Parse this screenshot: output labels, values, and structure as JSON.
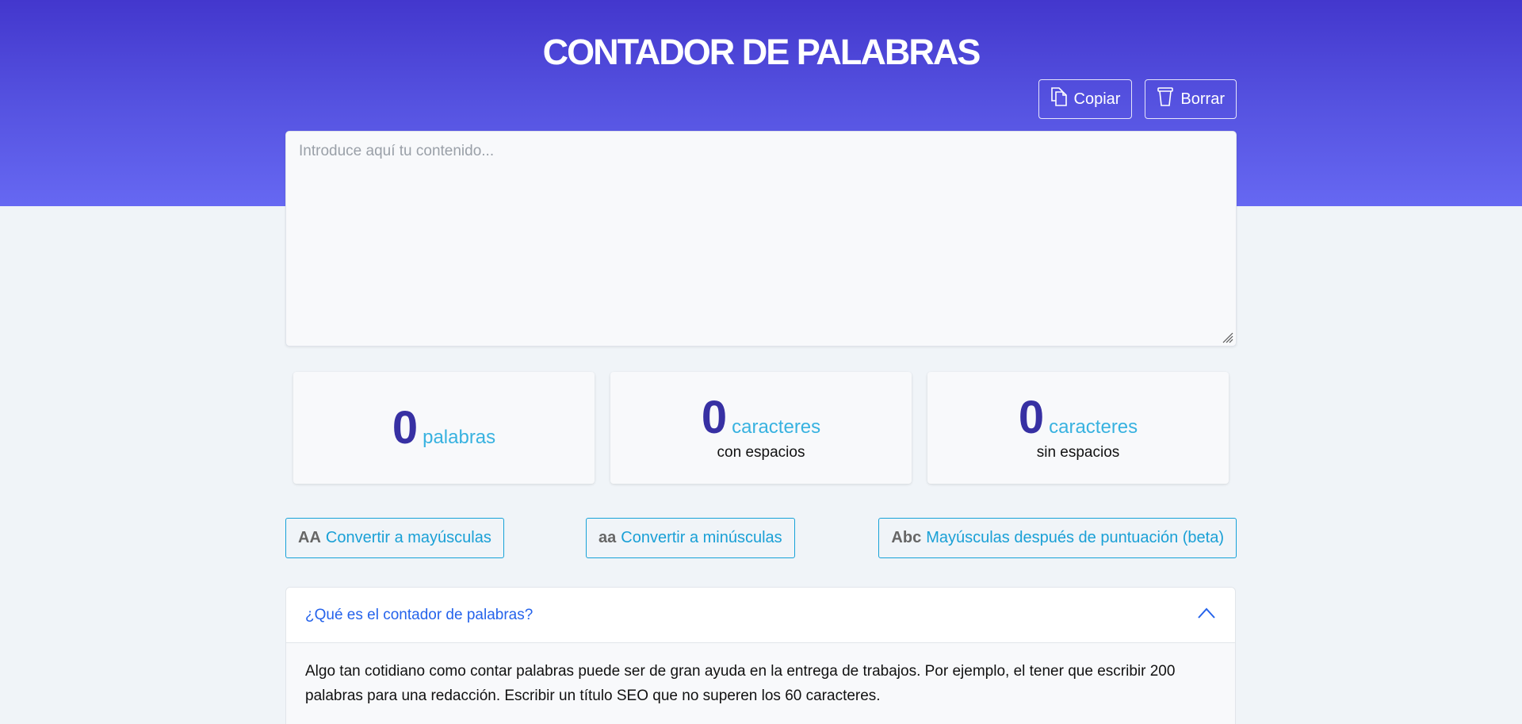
{
  "header": {
    "title": "CONTADOR DE PALABRAS",
    "copy_label": "Copiar",
    "clear_label": "Borrar",
    "copy_icon": "copy-icon",
    "clear_icon": "trash-icon"
  },
  "editor": {
    "placeholder": "Introduce aquí tu contenido...",
    "value": ""
  },
  "stats": [
    {
      "value": "0",
      "unit": "palabras",
      "sub": ""
    },
    {
      "value": "0",
      "unit": "caracteres",
      "sub": "con espacios"
    },
    {
      "value": "0",
      "unit": "caracteres",
      "sub": "sin espacios"
    }
  ],
  "converters": [
    {
      "icon": "AA",
      "label": "Convertir a mayúsculas"
    },
    {
      "icon": "aa",
      "label": "Convertir a minúsculas"
    },
    {
      "icon": "Abc",
      "label": "Mayúsculas después de puntuación (beta)"
    }
  ],
  "faq": {
    "question": "¿Qué es el contador de palabras?",
    "answer": "Algo tan cotidiano como contar palabras puede ser de gran ayuda en la entrega de trabajos. Por ejemplo, el tener que escribir 200 palabras para una redacción. Escribir un título SEO que no superen los 60 caracteres.",
    "expanded": true,
    "toggle_icon": "chevron-up-icon"
  },
  "colors": {
    "hero_top": "#4337cd",
    "hero_bottom": "#6668f2",
    "count_number": "#3730a3",
    "accent": "#38b2e0",
    "link": "#2563eb"
  }
}
